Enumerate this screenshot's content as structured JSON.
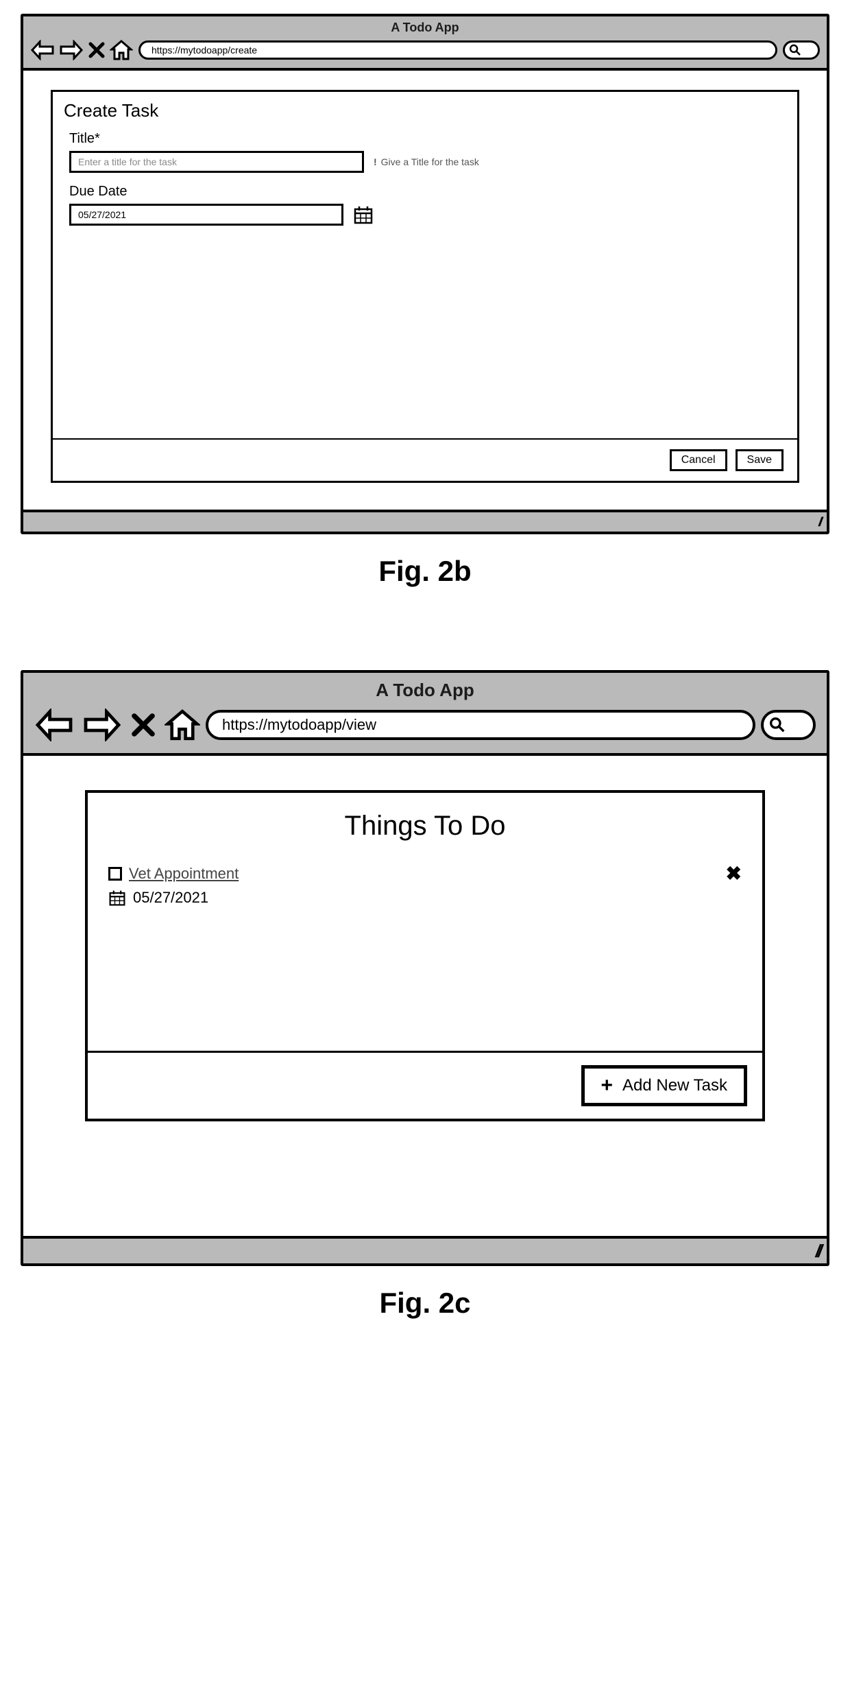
{
  "figure_b": {
    "caption": "Fig. 2b",
    "window_title": "A Todo App",
    "url": "https://mytodoapp/create",
    "panel": {
      "heading": "Create Task",
      "title_field": {
        "label": "Title*",
        "placeholder": "Enter a title for the task",
        "hint": "Give a Title for the task",
        "hint_icon": "!"
      },
      "due_date_field": {
        "label": "Due Date",
        "value": "05/27/2021"
      },
      "buttons": {
        "cancel": "Cancel",
        "save": "Save"
      }
    },
    "resize_grip": "//"
  },
  "figure_c": {
    "caption": "Fig. 2c",
    "window_title": "A Todo App",
    "url": "https://mytodoapp/view",
    "panel": {
      "heading": "Things To Do",
      "task": {
        "title": "Vet Appointment",
        "due_date": "05/27/2021"
      },
      "add_button": "Add New Task",
      "add_icon": "+"
    },
    "resize_grip": "//"
  }
}
